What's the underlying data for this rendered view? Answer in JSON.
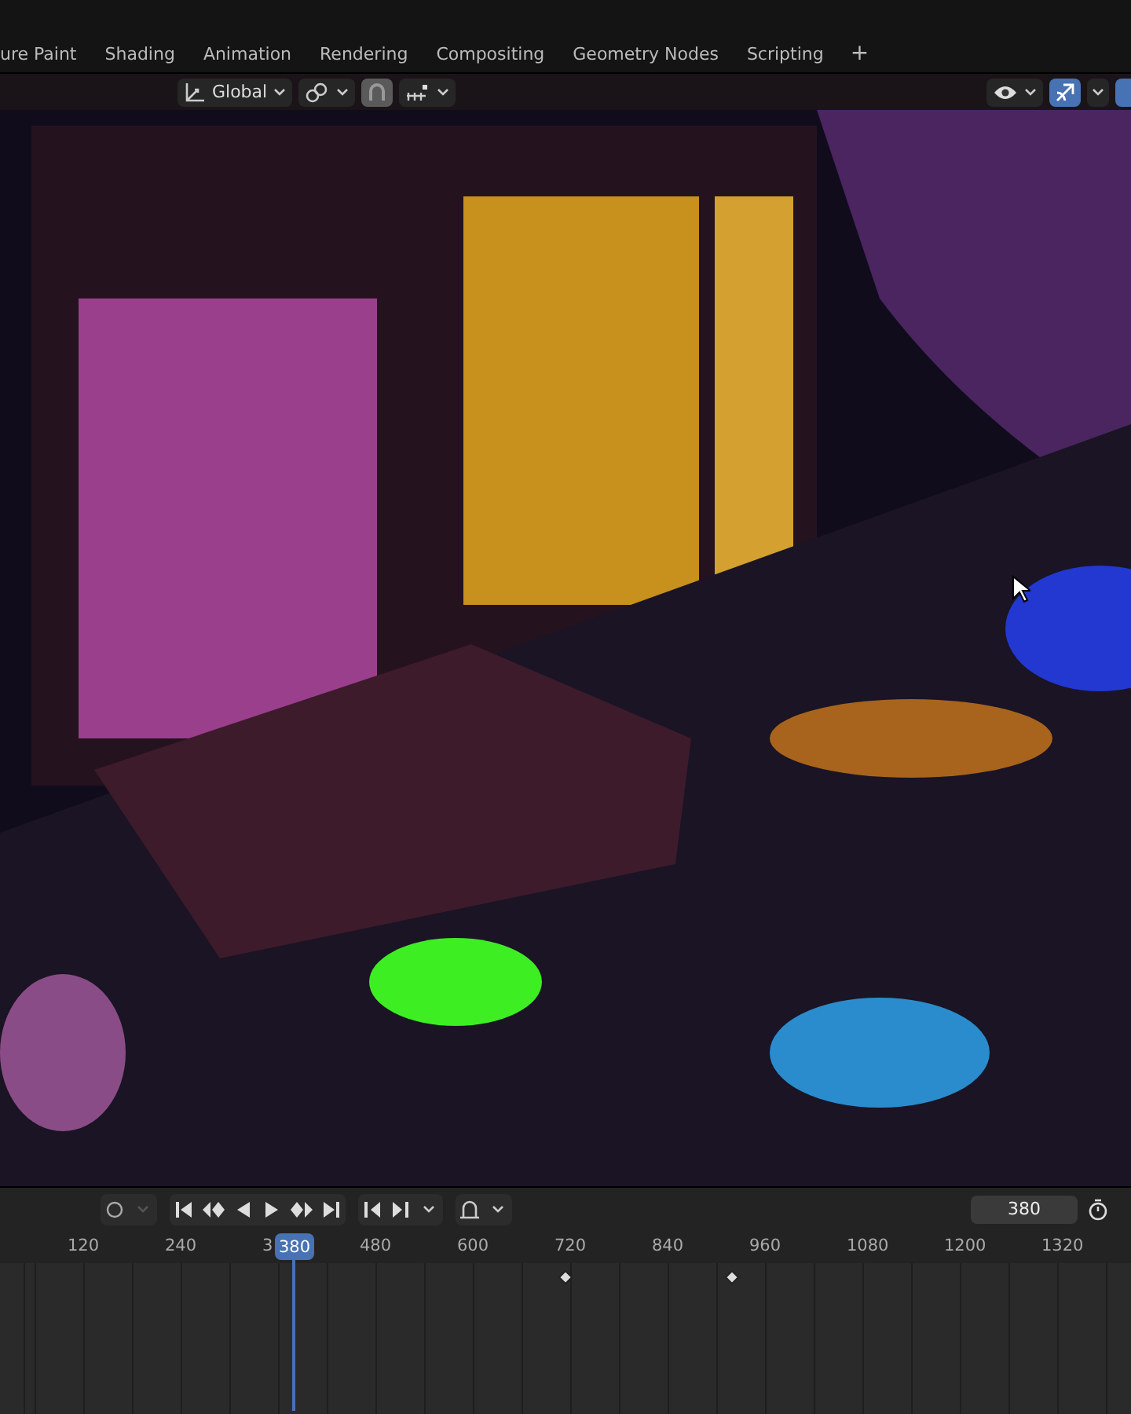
{
  "workspace_tabs": [
    {
      "label": "ure Paint",
      "selected": false
    },
    {
      "label": "Shading",
      "selected": false
    },
    {
      "label": "Animation",
      "selected": false
    },
    {
      "label": "Rendering",
      "selected": false
    },
    {
      "label": "Compositing",
      "selected": false
    },
    {
      "label": "Geometry Nodes",
      "selected": false
    },
    {
      "label": "Scripting",
      "selected": false
    }
  ],
  "add_tab": "+",
  "viewport_header": {
    "orientation": "Global",
    "snap_on": true,
    "gizmo_on": true
  },
  "timeline": {
    "auto_key_on": false,
    "current_frame": "380",
    "frame_field": "380",
    "ruler": [
      {
        "label": "120"
      },
      {
        "label": "240"
      },
      {
        "label": "3"
      },
      {
        "label": "480"
      },
      {
        "label": "600"
      },
      {
        "label": "720"
      },
      {
        "label": "840"
      },
      {
        "label": "960"
      },
      {
        "label": "1080"
      },
      {
        "label": "1200"
      },
      {
        "label": "1320"
      }
    ]
  }
}
